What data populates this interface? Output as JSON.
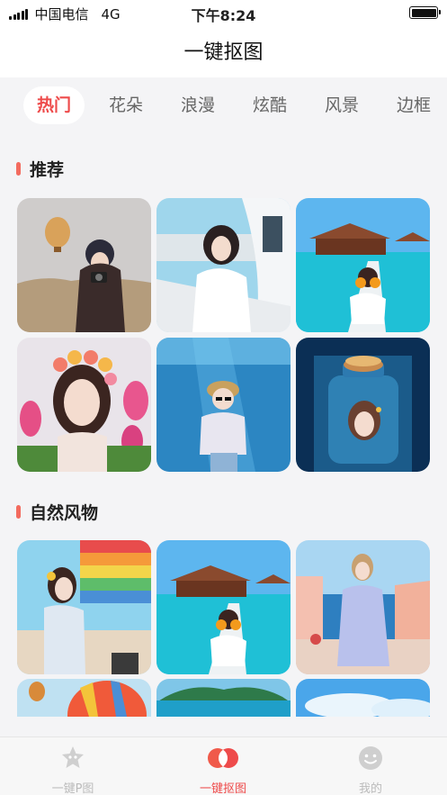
{
  "status_bar": {
    "carrier": "中国电信",
    "network": "4G",
    "time": "下午8:24"
  },
  "header": {
    "title": "一键抠图"
  },
  "categories": [
    "热门",
    "花朵",
    "浪漫",
    "炫酷",
    "风景",
    "边框"
  ],
  "selected_category": "热门",
  "sections": [
    {
      "title": "推荐",
      "items": [
        "balloon-desert-girl",
        "yacht-girl",
        "overwater-villa-girl",
        "tulip-flower-crown-girl",
        "underwater-girl",
        "bottle-fantasy-girl"
      ]
    },
    {
      "title": "自然风物",
      "items": [
        "rainbow-wall-girl",
        "overwater-villa-girl",
        "coastal-town-girl",
        "hot-air-balloon",
        "island-sea",
        "sky-clouds"
      ]
    }
  ],
  "tab_bar": {
    "items": [
      {
        "label": "一键P图",
        "icon": "star-face-icon"
      },
      {
        "label": "一键抠图",
        "icon": "overlap-circles-icon"
      },
      {
        "label": "我的",
        "icon": "smiley-icon"
      }
    ],
    "active_index": 1
  },
  "colors": {
    "accent": "#ee4b4b",
    "section_bar": "#f36b5f",
    "background": "#f4f4f6"
  }
}
